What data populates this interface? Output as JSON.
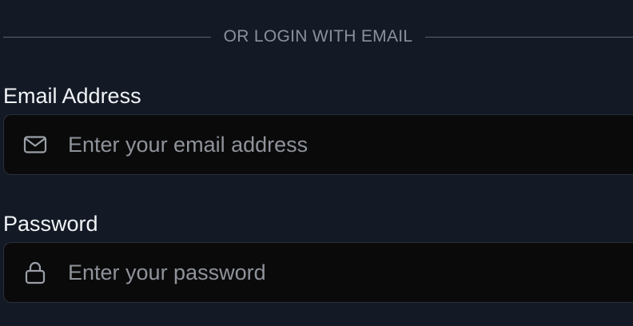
{
  "divider": {
    "text": "OR LOGIN WITH EMAIL"
  },
  "email": {
    "label": "Email Address",
    "placeholder": "Enter your email address",
    "icon": "mail-icon"
  },
  "password": {
    "label": "Password",
    "placeholder": "Enter your password",
    "icon": "lock-icon"
  },
  "colors": {
    "background": "#131a26",
    "input_background": "#0a0a0b",
    "input_border": "#2a2f38",
    "label_text": "#f1f3f6",
    "placeholder_text": "#8f939a",
    "divider_line": "#5b6271"
  }
}
